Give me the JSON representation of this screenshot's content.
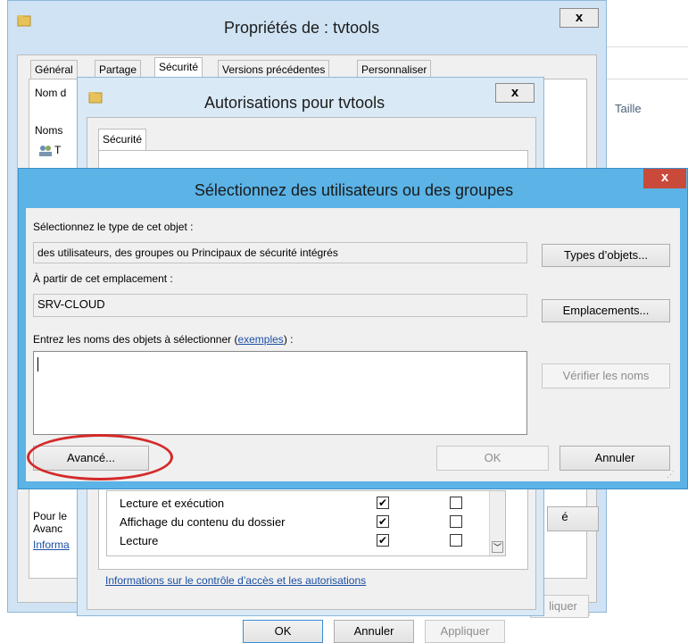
{
  "background_window": {
    "header_taille": "Taille"
  },
  "props_dialog": {
    "title": "Propriétés de : tvtools",
    "close": "x",
    "tabs": [
      "Général",
      "Partage",
      "Sécurité",
      "Versions précédentes",
      "Personnaliser"
    ],
    "nom_label": "Nom d",
    "noms_label": "Noms",
    "user_partial": "T",
    "pour_text": "Pour le",
    "avanc_text": "Avanc",
    "info_link": "Informa",
    "right_btn_partial": "é",
    "apply_partial": "liquer"
  },
  "auth_dialog": {
    "title": "Autorisations pour tvtools",
    "close": "x",
    "tab": "Sécurité",
    "perms": [
      {
        "name": "Lecture et exécution",
        "allow": true,
        "deny": false
      },
      {
        "name": "Affichage du contenu du dossier",
        "allow": true,
        "deny": false
      },
      {
        "name": "Lecture",
        "allow": true,
        "deny": false
      }
    ],
    "check_mark": "✔",
    "info_link": "Informations sur le contrôle d’accès et les autorisations",
    "ok": "OK",
    "annuler": "Annuler",
    "appliquer": "Appliquer"
  },
  "select_dialog": {
    "title": "Sélectionnez des utilisateurs ou des groupes",
    "close": "x",
    "type_label": "Sélectionnez le type de cet objet :",
    "type_value": "des utilisateurs, des groupes ou Principaux de sécurité intégrés",
    "types_btn": "Types d’objets...",
    "location_label": "À partir de cet emplacement :",
    "location_value": "SRV-CLOUD",
    "locations_btn": "Emplacements...",
    "names_label_prefix": "Entrez les noms des objets à sélectionner (",
    "names_label_link": "exemples",
    "names_label_suffix": ") :",
    "names_value": "",
    "verify_btn": "Vérifier les noms",
    "advanced_btn": "Avancé...",
    "ok_btn": "OK",
    "cancel_btn": "Annuler"
  },
  "colors": {
    "accent_frame": "#5bb3e6",
    "highlight_circle": "#d42a2a",
    "link": "#1a4fa3"
  }
}
